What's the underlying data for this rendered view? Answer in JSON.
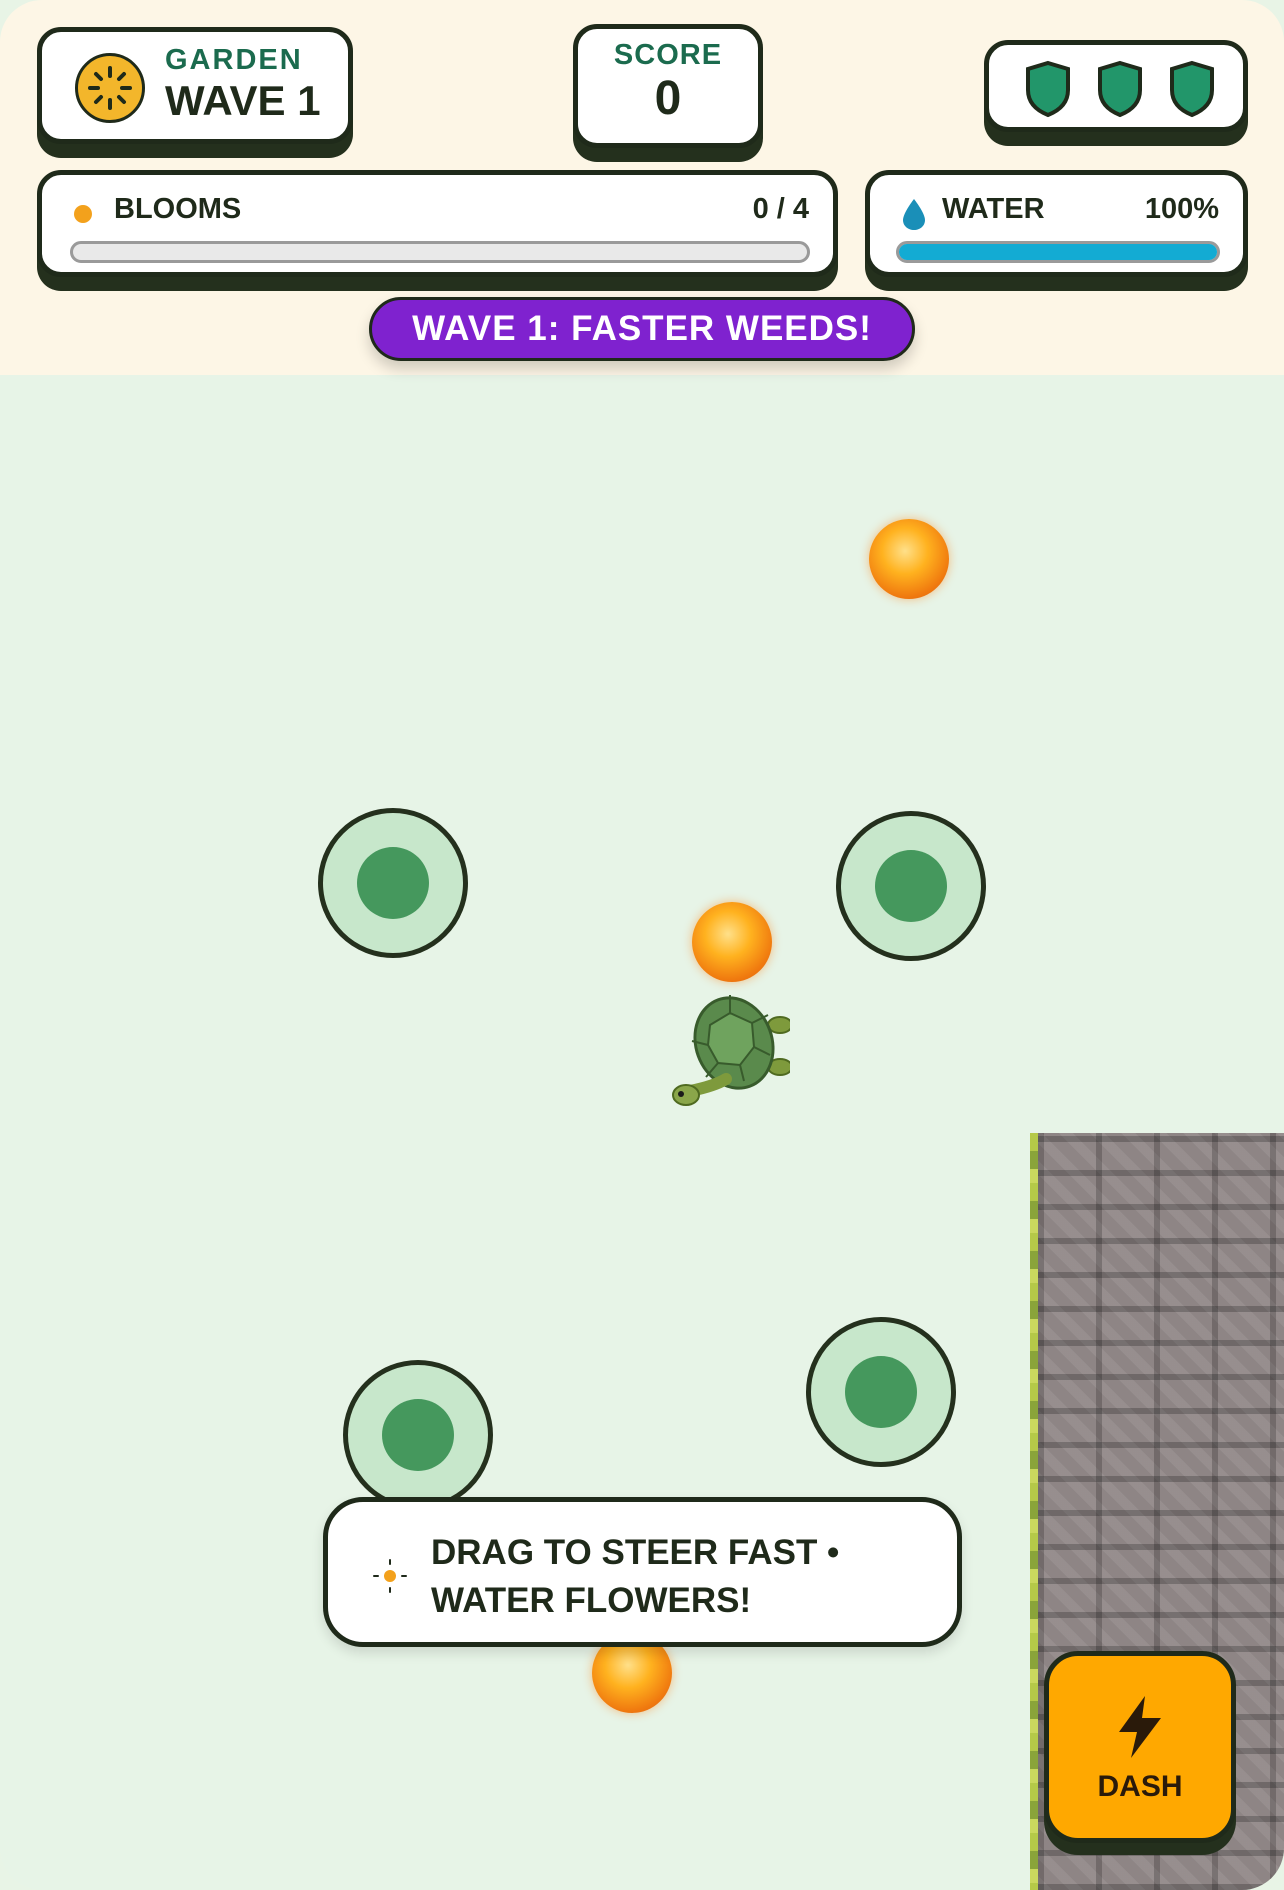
{
  "hud": {
    "garden_label": "GARDEN",
    "wave_label": "WAVE 1",
    "score_label": "SCORE",
    "score_value": "0",
    "lives": {
      "count": 3,
      "icon": "shield-icon",
      "color": "#22966a"
    },
    "blooms": {
      "label": "BLOOMS",
      "value_text": "0 / 4",
      "progress": 0,
      "dot_color": "#f3a11c"
    },
    "water": {
      "label": "WATER",
      "value_text": "100%",
      "progress": 1.0,
      "color": "#13abd3"
    }
  },
  "banner": {
    "text": "WAVE 1: FASTER WEEDS!",
    "color": "#7f22cf"
  },
  "hint": {
    "text": "DRAG TO STEER FAST • WATER FLOWERS!",
    "icon": "sun-sparkle-icon"
  },
  "dash_button": {
    "label": "DASH",
    "icon": "lightning-icon",
    "color": "#ffa800"
  },
  "field": {
    "player": "turtle",
    "flower_plots": 4,
    "weeds": 3
  }
}
